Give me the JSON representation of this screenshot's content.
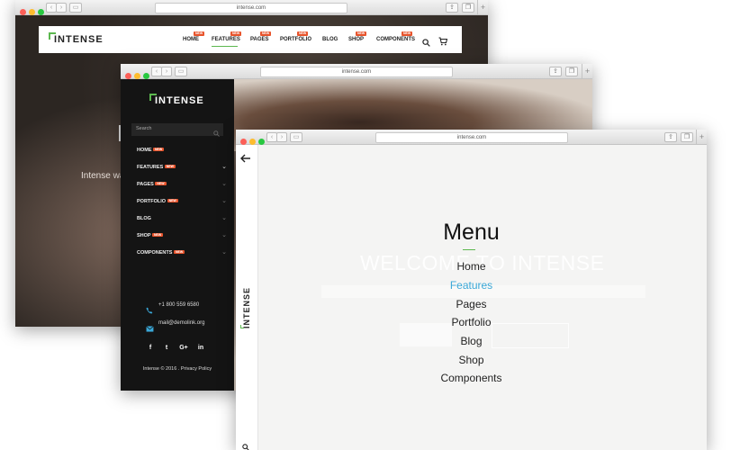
{
  "window1": {
    "url": "intense.com",
    "logo": "INTENSE",
    "nav": [
      {
        "label": "HOME",
        "badge": "NEW"
      },
      {
        "label": "FEATURES",
        "badge": "NEW"
      },
      {
        "label": "PAGES",
        "badge": "NEW"
      },
      {
        "label": "PORTFOLIO",
        "badge": "NEW"
      },
      {
        "label": "BLOG",
        "badge": ""
      },
      {
        "label": "SHOP",
        "badge": "NEW"
      },
      {
        "label": "COMPONENTS",
        "badge": "NEW"
      }
    ],
    "hero_text": "Intense wa",
    "accent": "#5cb84f",
    "badge_color": "#e8542c"
  },
  "window2": {
    "url": "intense.com",
    "logo": "INTENSE",
    "search_placeholder": "Search",
    "items": [
      {
        "label": "HOME",
        "badge": "NEW"
      },
      {
        "label": "FEATURES",
        "badge": "NEW"
      },
      {
        "label": "PAGES",
        "badge": "NEW"
      },
      {
        "label": "PORTFOLIO",
        "badge": "NEW"
      },
      {
        "label": "BLOG",
        "badge": ""
      },
      {
        "label": "SHOP",
        "badge": "NEW"
      },
      {
        "label": "COMPONENTS",
        "badge": "NEW"
      }
    ],
    "phone": "+1 800 559 6580",
    "email": "mail@demolink.org",
    "social": [
      "f",
      "t",
      "G+",
      "in"
    ],
    "copyright": "Intense © 2016 . Privacy Policy"
  },
  "window3": {
    "url": "intense.com",
    "vertical_logo": "INTENSE",
    "menu_title": "Menu",
    "items": [
      "Home",
      "Features",
      "Pages",
      "Portfolio",
      "Blog",
      "Shop",
      "Components"
    ],
    "active_item": "Features",
    "active_color": "#3aa8d8",
    "ghost_heading": "WELCOME TO INTENSE"
  }
}
